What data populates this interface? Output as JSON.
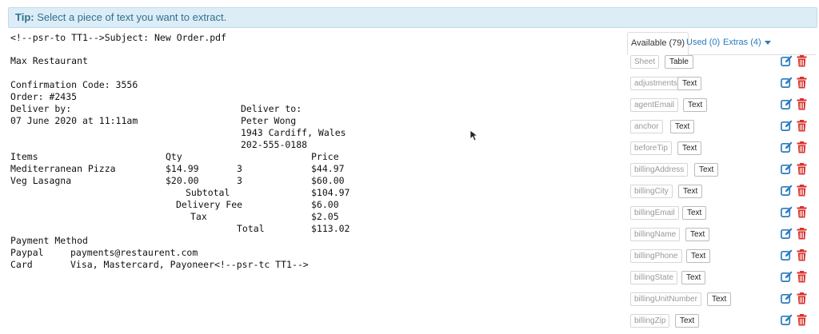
{
  "tip": {
    "label": "Tip:",
    "text": "Select a piece of text you want to extract."
  },
  "document": {
    "header": "<!--psr-to TT1-->Subject: New Order.pdf",
    "restaurant": "Max Restaurant",
    "confirmation": "Confirmation Code: 3556",
    "order": "Order: #2435",
    "deliver_by_label": "Deliver by:",
    "deliver_by_value": "07 June 2020 at 11:11am",
    "deliver_to_label": "Deliver to:",
    "deliver_to_name": "Peter Wong",
    "deliver_to_address": "1943 Cardiff, Wales",
    "deliver_to_phone": "202-555-0188",
    "items_header": {
      "items": "Items",
      "qty": "Qty",
      "price": "Price"
    },
    "items": [
      {
        "name": "Mediterranean Pizza",
        "unit": "$14.99",
        "qty": "3",
        "price": "$44.97"
      },
      {
        "name": "Veg Lasagna",
        "unit": "$20.00",
        "qty": "3",
        "price": "$60.00"
      }
    ],
    "totals": [
      {
        "label": "Subtotal",
        "value": "$104.97"
      },
      {
        "label": "Delivery Fee",
        "value": "$6.00"
      },
      {
        "label": "Tax",
        "value": "$2.05"
      },
      {
        "label": "Total",
        "value": "$113.02"
      }
    ],
    "payment_title": "Payment Method",
    "payments": [
      {
        "method": "Paypal",
        "detail": "payments@restaurent.com"
      },
      {
        "method": "Card",
        "detail": "Visa, Mastercard, Payoneer<!--psr-tc TT1-->"
      }
    ]
  },
  "panel": {
    "tabs": [
      {
        "label": "Available (79)",
        "active": true
      },
      {
        "label": "Used (0)",
        "active": false
      },
      {
        "label": "Extras (4)",
        "active": false
      }
    ],
    "fields": [
      {
        "name": "Sheet",
        "type": "Table"
      },
      {
        "name": "adjustments",
        "type": "Text"
      },
      {
        "name": "agentEmail",
        "type": "Text"
      },
      {
        "name": "anchor",
        "type": "Text"
      },
      {
        "name": "beforeTip",
        "type": "Text"
      },
      {
        "name": "billingAddress",
        "type": "Text"
      },
      {
        "name": "billingCity",
        "type": "Text"
      },
      {
        "name": "billingEmail",
        "type": "Text"
      },
      {
        "name": "billingName",
        "type": "Text"
      },
      {
        "name": "billingPhone",
        "type": "Text"
      },
      {
        "name": "billingState",
        "type": "Text"
      },
      {
        "name": "billingUnitNumber",
        "type": "Text"
      },
      {
        "name": "billingZip",
        "type": "Text"
      }
    ],
    "colors": {
      "edit": "#2a7bbd",
      "delete": "#d9312b",
      "link": "#2a7bbd"
    },
    "icons": {
      "edit": "edit-icon",
      "delete": "trash-icon",
      "dropdown": "caret-down-icon"
    }
  }
}
